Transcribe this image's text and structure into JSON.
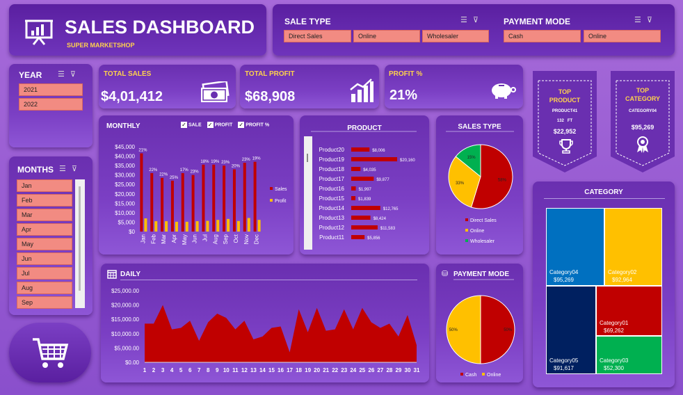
{
  "header": {
    "title": "SALES DASHBOARD",
    "subtitle": "SUPER MARKETSHOP"
  },
  "sale_type": {
    "title": "SALE TYPE",
    "items": [
      "Direct Sales",
      "Online",
      "Wholesaler"
    ]
  },
  "payment_mode": {
    "title": "PAYMENT MODE",
    "items": [
      "Cash",
      "Online"
    ]
  },
  "year": {
    "title": "YEAR",
    "items": [
      "2021",
      "2022"
    ]
  },
  "months": {
    "title": "MONTHS",
    "items": [
      "Jan",
      "Feb",
      "Mar",
      "Apr",
      "May",
      "Jun",
      "Jul",
      "Aug",
      "Sep"
    ]
  },
  "kpis": {
    "total_sales": {
      "label": "TOTAL SALES",
      "value": "$4,01,412"
    },
    "total_profit": {
      "label": "TOTAL PROFIT",
      "value": "$68,908"
    },
    "profit_pct": {
      "label": "PROFIT %",
      "value": "21%"
    }
  },
  "top_product": {
    "label": "TOP PRODUCT",
    "name": "PRODUCT41",
    "qty": "132",
    "unit": "FT",
    "value": "$22,952"
  },
  "top_category": {
    "label": "TOP CATEGORY",
    "name": "CATEGORY04",
    "value": "$95,269"
  },
  "colors": {
    "red": "#c00000",
    "yellow": "#ffc000",
    "green": "#00b050",
    "blue": "#0070c0",
    "navy": "#002060",
    "salmon": "#f28b82"
  },
  "chart_data": [
    {
      "type": "bar",
      "title": "MONTHLY",
      "checkboxes": [
        "SALE",
        "PROFIT",
        "PROFIT %"
      ],
      "categories": [
        "Jan",
        "Feb",
        "Mar",
        "Apr",
        "May",
        "Jun",
        "Jul",
        "Aug",
        "Sep",
        "Oct",
        "Nov",
        "Dec"
      ],
      "series": [
        {
          "name": "Sales",
          "values": [
            41500,
            31000,
            28500,
            27000,
            31000,
            30000,
            35500,
            35500,
            35000,
            33000,
            36500,
            37000
          ]
        },
        {
          "name": "Profit",
          "values": [
            7000,
            5500,
            5500,
            5200,
            5200,
            5500,
            5700,
            6200,
            6700,
            5600,
            7200,
            6200
          ]
        }
      ],
      "data_labels": [
        "21%",
        "22%",
        "22%",
        "25%",
        "17%",
        "23%",
        "18%",
        "19%",
        "23%",
        "20%",
        "23%",
        "19%"
      ],
      "yticks": [
        "$45,000",
        "$40,000",
        "$35,000",
        "$30,000",
        "$25,000",
        "$20,000",
        "$15,000",
        "$10,000",
        "$5,000",
        "$0"
      ],
      "ylim": [
        0,
        45000
      ],
      "legend": "right"
    },
    {
      "type": "bar",
      "title": "PRODUCT",
      "categories": [
        "Product20",
        "Product19",
        "Product18",
        "Product17",
        "Product16",
        "Product15",
        "Product14",
        "Product13",
        "Product12",
        "Product11"
      ],
      "values": [
        8006,
        20160,
        4035,
        9877,
        1997,
        1839,
        12765,
        8424,
        11583,
        5856
      ],
      "data_labels": [
        "$8,006",
        "$20,160",
        "$4,035",
        "$9,877",
        "$1,997",
        "$1,839",
        "$12,765",
        "$8,424",
        "$11,583",
        "$5,856"
      ]
    },
    {
      "type": "pie",
      "title": "SALES TYPE",
      "labels": [
        "Direct Sales",
        "Online",
        "Wholesaler"
      ],
      "values": [
        58,
        33,
        15
      ],
      "data_labels": [
        "58%",
        "33%",
        "15%"
      ]
    },
    {
      "type": "area",
      "title": "DAILY",
      "x": [
        1,
        2,
        3,
        4,
        5,
        6,
        7,
        8,
        9,
        10,
        11,
        12,
        13,
        14,
        15,
        16,
        17,
        18,
        19,
        20,
        21,
        22,
        23,
        24,
        25,
        26,
        27,
        28,
        29,
        30,
        31
      ],
      "values": [
        13500,
        13500,
        20000,
        11500,
        12000,
        14500,
        7500,
        14000,
        17000,
        15500,
        11500,
        14500,
        8000,
        9000,
        12000,
        12500,
        3500,
        18500,
        10500,
        19000,
        11000,
        11500,
        18500,
        11500,
        19000,
        14000,
        12000,
        13500,
        9000,
        16500,
        6000
      ],
      "yticks": [
        "$25,000.00",
        "$20,000.00",
        "$15,000.00",
        "$10,000.00",
        "$5,000.00",
        "$0.00"
      ],
      "ylim": [
        0,
        25000
      ]
    },
    {
      "type": "pie",
      "title": "PAYMENT MODE",
      "labels": [
        "Cash",
        "Online"
      ],
      "values": [
        50,
        50
      ],
      "data_labels": [
        "50%",
        "50%"
      ]
    },
    {
      "type": "heatmap",
      "title": "CATEGORY",
      "labels": [
        "Category04",
        "Category02",
        "Category05",
        "Category01",
        "Category03"
      ],
      "values": [
        "$95,269",
        "$92,964",
        "$91,617",
        "$69,262",
        "$52,300"
      ]
    }
  ]
}
